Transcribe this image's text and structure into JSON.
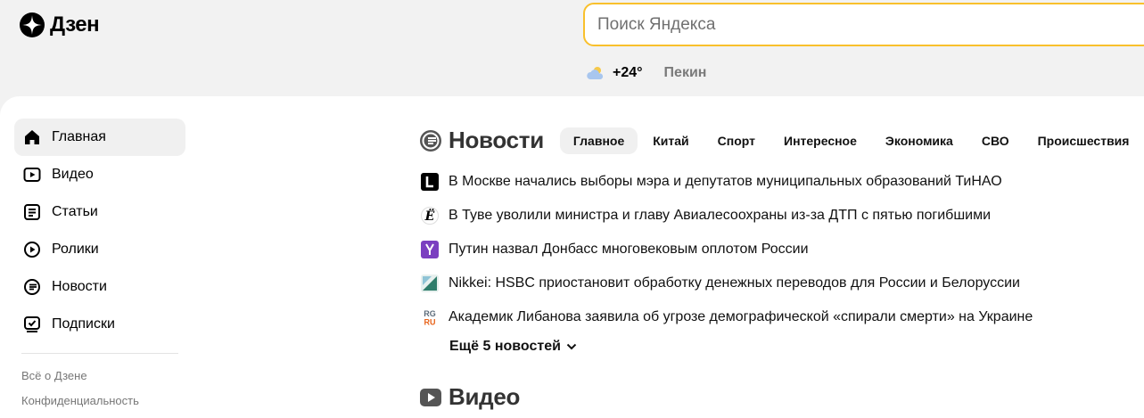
{
  "brand": {
    "name": "Дзен"
  },
  "search": {
    "placeholder": "Поиск Яндекса"
  },
  "weather": {
    "icon": "cloud-icon",
    "temperature": "+24°",
    "city": "Пекин"
  },
  "sidebar": {
    "items": [
      {
        "label": "Главная",
        "icon": "home-icon",
        "active": true
      },
      {
        "label": "Видео",
        "icon": "video-icon"
      },
      {
        "label": "Статьи",
        "icon": "article-icon"
      },
      {
        "label": "Ролики",
        "icon": "clips-icon"
      },
      {
        "label": "Новости",
        "icon": "news-icon"
      },
      {
        "label": "Подписки",
        "icon": "subscriptions-icon"
      }
    ],
    "footer_links": [
      "Всё о Дзене",
      "Конфиденциальность"
    ]
  },
  "news": {
    "title": "Новости",
    "tabs": [
      "Главное",
      "Китай",
      "Спорт",
      "Интересное",
      "Экономика",
      "СВО",
      "Происшествия"
    ],
    "active_tab": "Главное",
    "items": [
      {
        "text": "В Москве начались выборы мэра и депутатов муниципальных образований ТиНАО",
        "source_icon": "L",
        "source_color": "#000000"
      },
      {
        "text": "В Туве уволили министра и главу Авиалесоохраны из-за ДТП с пятью погибшими",
        "source_icon": "Ё",
        "source_color": "#ffffff"
      },
      {
        "text": "Путин назвал Донбасс многовековым оплотом России",
        "source_icon": "Y",
        "source_color": "#7b3fc0"
      },
      {
        "text": "Nikkei: HSBC приостановит обработку денежных переводов для России и Белоруссии",
        "source_icon": "triangle",
        "source_color": "#2f7d6b"
      },
      {
        "text": "Академик Либанова заявила об угрозе демографической «спирали смерти» на Украине",
        "source_icon": "RG RU",
        "source_color": "#5b6b7a"
      }
    ],
    "more_label": "Ещё 5 новостей"
  },
  "video": {
    "title": "Видео"
  },
  "colors": {
    "accent": "#f9c02c",
    "background": "#f2f2f2",
    "panel": "#ffffff"
  }
}
